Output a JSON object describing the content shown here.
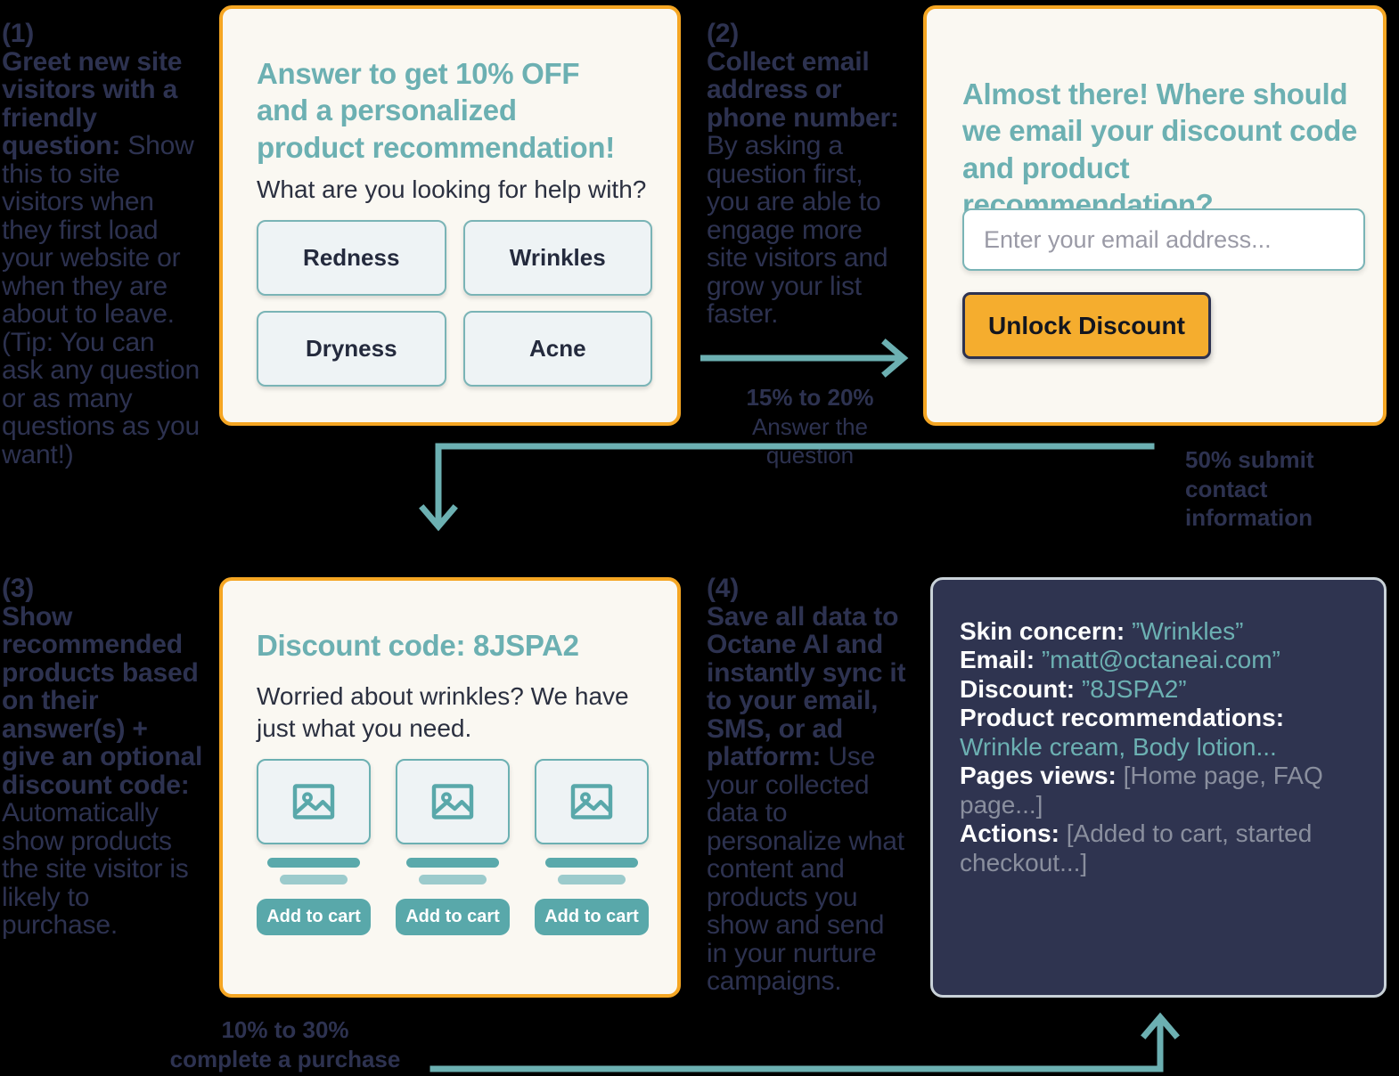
{
  "colors": {
    "background": "#000000",
    "card_bg": "#faf8f2",
    "card_border": "#f5a623",
    "teal": "#6cb0b2",
    "navy": "#2d3250",
    "panel_bg": "#2f3450",
    "panel_border": "#c9d2d8",
    "option_bg": "#eef3f5",
    "muted_gray": "#8a8f9e"
  },
  "steps": [
    {
      "number": "(1)",
      "lead": "Greet new site visitors with a friendly question:",
      "body": " Show this to site visitors when they first load your website or when they are about to leave. (Tip: You can ask any question or as many questions as you want!)"
    },
    {
      "number": "(2)",
      "lead": "Collect email address or phone number:",
      "body": " By asking a question first, you are able to engage more site visitors and grow your list faster."
    },
    {
      "number": "(3)",
      "lead": "Show recommended products based on their answer(s) + give an optional discount code:",
      "body": " Automatically show products the site visitor is likely to purchase."
    },
    {
      "number": "(4)",
      "lead": "Save all data to Octane AI and instantly sync it to your email, SMS, or ad platform:",
      "body": " Use your collected data to personalize what content and products you show and send in your nurture campaigns."
    }
  ],
  "card_question": {
    "title": "Answer to get 10% OFF and a personalized product recommendation!",
    "subtitle": "What are you looking for help with?",
    "options": [
      {
        "label": "Redness"
      },
      {
        "label": "Wrinkles"
      },
      {
        "label": "Dryness"
      },
      {
        "label": "Acne"
      }
    ]
  },
  "card_email": {
    "title": "Almost there! Where should we email your discount code and product recommendation?",
    "input_placeholder": "Enter your email address...",
    "input_value": "",
    "submit_label": "Unlock Discount"
  },
  "card_products": {
    "title": "Discount code: 8JSPA2",
    "subtitle": "Worried about wrinkles? We have just what you need.",
    "products": [
      {
        "image_icon": "image-placeholder-icon",
        "cart_label": "Add to cart"
      },
      {
        "image_icon": "image-placeholder-icon",
        "cart_label": "Add to cart"
      },
      {
        "image_icon": "image-placeholder-icon",
        "cart_label": "Add to cart"
      }
    ]
  },
  "data_panel": {
    "rows": [
      {
        "label": "Skin concern:",
        "value": "”Wrinkles”",
        "tone": "teal"
      },
      {
        "label": "Email:",
        "value": "”matt@octaneai.com”",
        "tone": "teal"
      },
      {
        "label": "Discount:",
        "value": "”8JSPA2”",
        "tone": "teal"
      },
      {
        "label": "Product recommendations:",
        "value": "Wrinkle cream, Body lotion...",
        "tone": "teal"
      },
      {
        "label": "Pages views:",
        "value": "[Home page, FAQ page...]",
        "tone": "gray"
      },
      {
        "label": "Actions:",
        "value": "[Added to cart, started checkout...]",
        "tone": "gray"
      }
    ]
  },
  "flows": [
    {
      "id": "flow-1-2",
      "percent": "15% to 20%",
      "text": "Answer the question",
      "icon": "arrow-right-icon"
    },
    {
      "id": "flow-2-3",
      "percent": "50% submit",
      "text": "contact information",
      "icon": "arrow-down-icon"
    },
    {
      "id": "flow-3-4",
      "percent": "10% to 30%",
      "text": "complete a purchase",
      "icon": "arrow-up-icon"
    }
  ]
}
